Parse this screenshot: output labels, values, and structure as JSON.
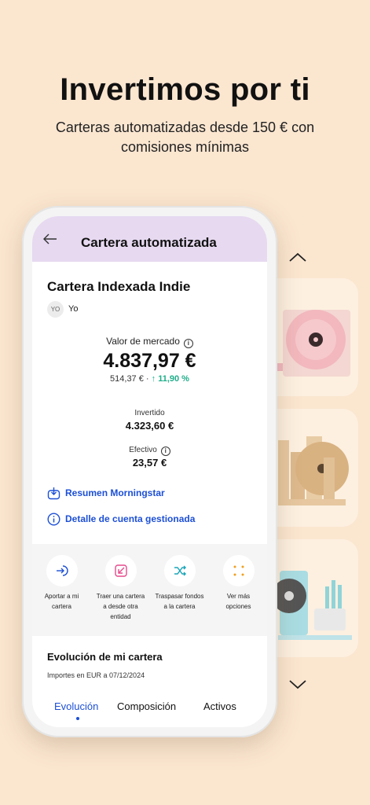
{
  "hero": {
    "title": "Invertimos por ti",
    "subtitle": "Carteras automatizadas desde 150 € con comisiones mínimas"
  },
  "app": {
    "topbar": {
      "title": "Cartera automatizada",
      "back_icon": "arrow-left-icon"
    },
    "portfolio": {
      "name": "Cartera Indexada Indie",
      "owner_initials": "YO",
      "owner_name": "Yo"
    },
    "market_value": {
      "label": "Valor de mercado",
      "value": "4.837,97 €",
      "change_amount": "514,37 € ·",
      "change_percent": "11,90 %"
    },
    "invested": {
      "label": "Invertido",
      "value": "4.323,60 €"
    },
    "cash": {
      "label": "Efectivo",
      "value": "23,57 €"
    },
    "links": {
      "morningstar": "Resumen Morningstar",
      "managed_account": "Detalle de cuenta gestionada"
    },
    "actions": [
      {
        "label": "Aportar a mi cartera",
        "icon": "deposit-arrow-icon"
      },
      {
        "label": "Traer una cartera a desde otra entidad",
        "icon": "transfer-in-icon"
      },
      {
        "label": "Traspasar fondos a la cartera",
        "icon": "shuffle-icon"
      },
      {
        "label": "Ver más opciones",
        "icon": "more-dots-icon"
      }
    ],
    "evolution": {
      "title": "Evolución de mi cartera",
      "subtitle": "Importes en EUR a 07/12/2024"
    },
    "tabs": [
      "Evolución",
      "Composición",
      "Activos"
    ]
  },
  "colors": {
    "background": "#fbe6d0",
    "topbar": "#e6d9f0",
    "link_blue": "#1c4fd6",
    "gain_green": "#1fae8a"
  }
}
